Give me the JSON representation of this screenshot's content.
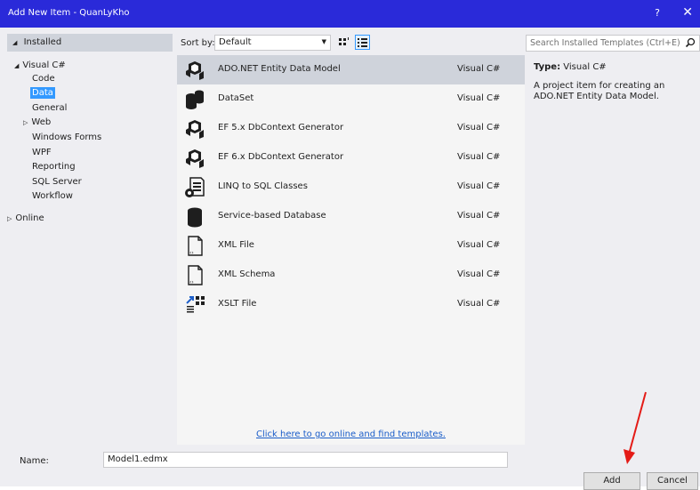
{
  "window": {
    "title": "Add New Item - QuanLyKho",
    "help_label": "?",
    "close_label": "✕"
  },
  "tree": {
    "installed_label": "Installed",
    "items": [
      {
        "label": "Visual C#",
        "expanded": true
      },
      {
        "label": "Code"
      },
      {
        "label": "Data",
        "selected": true
      },
      {
        "label": "General"
      },
      {
        "label": "Web",
        "collapsed": true
      },
      {
        "label": "Windows Forms"
      },
      {
        "label": "WPF"
      },
      {
        "label": "Reporting"
      },
      {
        "label": "SQL Server"
      },
      {
        "label": "Workflow"
      },
      {
        "label": "Online",
        "collapsed": true
      }
    ]
  },
  "toolbar": {
    "sort_by_label": "Sort by:",
    "sort_by_value": "Default",
    "search_placeholder": "Search Installed Templates (Ctrl+E)"
  },
  "templates": [
    {
      "name": "ADO.NET Entity Data Model",
      "language": "Visual C#",
      "icon": "entity-model-icon",
      "selected": true
    },
    {
      "name": "DataSet",
      "language": "Visual C#",
      "icon": "dataset-icon"
    },
    {
      "name": "EF 5.x DbContext Generator",
      "language": "Visual C#",
      "icon": "ef-generator-icon"
    },
    {
      "name": "EF 6.x DbContext Generator",
      "language": "Visual C#",
      "icon": "ef-generator-icon"
    },
    {
      "name": "LINQ to SQL Classes",
      "language": "Visual C#",
      "icon": "linq-sql-icon"
    },
    {
      "name": "Service-based Database",
      "language": "Visual C#",
      "icon": "database-icon"
    },
    {
      "name": "XML File",
      "language": "Visual C#",
      "icon": "xml-file-icon"
    },
    {
      "name": "XML Schema",
      "language": "Visual C#",
      "icon": "xml-schema-icon"
    },
    {
      "name": "XSLT File",
      "language": "Visual C#",
      "icon": "xslt-file-icon"
    }
  ],
  "details": {
    "type_label": "Type:",
    "type_value": "Visual C#",
    "description": "A project item for creating an ADO.NET Entity Data Model."
  },
  "online_link": "Click here to go online and find templates.",
  "name_field": {
    "label": "Name:",
    "value": "Model1.edmx"
  },
  "buttons": {
    "add_label": "Add",
    "cancel_label": "Cancel"
  },
  "colors": {
    "title_bar": "#2a2ad9",
    "selection": "#3399ff",
    "annotation_arrow": "#e41b17"
  }
}
